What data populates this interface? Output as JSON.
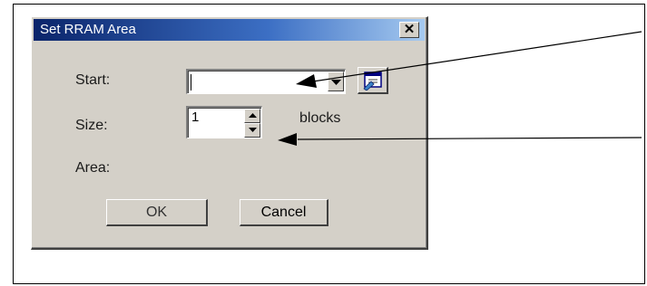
{
  "dialog": {
    "title": "Set RRAM Area",
    "close_label": "✕",
    "start_label": "Start:",
    "start_value": "",
    "size_label": "Size:",
    "size_value": "1",
    "size_unit": "blocks",
    "area_label": "Area:",
    "area_value": "",
    "ok_label": "OK",
    "cancel_label": "Cancel"
  },
  "icons": {
    "dropdown": "chevron-down-icon",
    "browse": "browse-window-icon",
    "spin_up": "spin-up-icon",
    "spin_down": "spin-down-icon",
    "close": "close-icon"
  },
  "colors": {
    "dialog_face": "#d4d0c8",
    "title_start": "#0a246a",
    "title_end": "#a6caf0"
  }
}
